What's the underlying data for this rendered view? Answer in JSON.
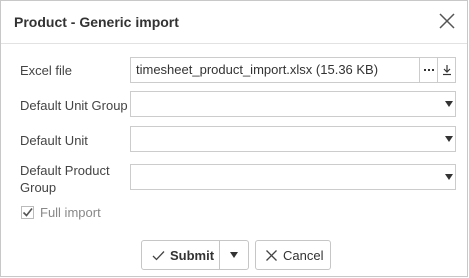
{
  "dialog": {
    "title": "Product - Generic import"
  },
  "form": {
    "excel_file": {
      "label": "Excel file",
      "value": "timesheet_product_import.xlsx (15.36 KB)"
    },
    "default_unit_group": {
      "label": "Default Unit Group",
      "value": ""
    },
    "default_unit": {
      "label": "Default Unit",
      "value": ""
    },
    "default_product_group": {
      "label_line1": "Default Product",
      "label_line2": "Group",
      "value": ""
    },
    "full_import": {
      "label": "Full import",
      "checked": true
    }
  },
  "footer": {
    "submit_label": "Submit",
    "cancel_label": "Cancel"
  },
  "icons": {
    "close": "close-icon",
    "browse": "ellipsis-icon",
    "download": "download-icon",
    "dropdown": "caret-down-icon",
    "check": "check-icon",
    "cancel": "x-icon"
  }
}
